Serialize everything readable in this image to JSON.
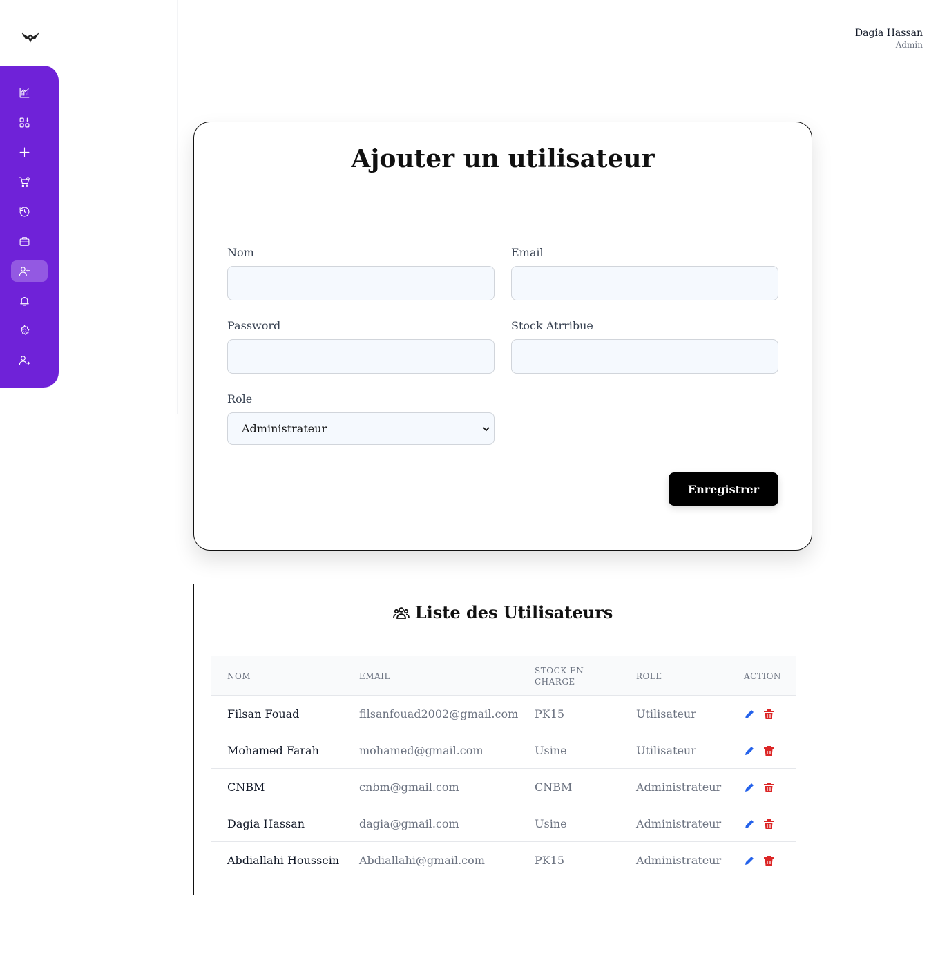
{
  "header": {
    "user_name": "Dagia Hassan",
    "user_role": "Admin"
  },
  "sidebar": {
    "accent_color": "#6f22d8",
    "items": [
      {
        "icon": "chart-icon",
        "active": false
      },
      {
        "icon": "grid-add-icon",
        "active": false
      },
      {
        "icon": "plus-icon",
        "active": false
      },
      {
        "icon": "cart-icon",
        "active": false
      },
      {
        "icon": "history-icon",
        "active": false
      },
      {
        "icon": "briefcase-icon",
        "active": false
      },
      {
        "icon": "user-add-icon",
        "active": true
      },
      {
        "icon": "bell-icon",
        "active": false
      },
      {
        "icon": "gear-icon",
        "active": false
      },
      {
        "icon": "user-logout-icon",
        "active": false
      }
    ]
  },
  "form": {
    "title": "Ajouter un utilisateur",
    "nom_label": "Nom",
    "nom_value": "",
    "email_label": "Email",
    "email_value": "",
    "password_label": "Password",
    "password_value": "",
    "stock_label": "Stock Atrribue",
    "stock_value": "",
    "role_label": "Role",
    "role_value": "Administrateur",
    "save_label": "Enregistrer"
  },
  "users": {
    "title": "Liste des Utilisateurs",
    "columns": [
      "NOM",
      "EMAIL",
      "STOCK EN CHARGE",
      "ROLE",
      "ACTION"
    ],
    "rows": [
      {
        "nom": "Filsan Fouad",
        "email": "filsanfouad2002@gmail.com",
        "stock": "PK15",
        "role": "Utilisateur"
      },
      {
        "nom": "Mohamed Farah",
        "email": "mohamed@gmail.com",
        "stock": "Usine",
        "role": "Utilisateur"
      },
      {
        "nom": "CNBM",
        "email": "cnbm@gmail.com",
        "stock": "CNBM",
        "role": "Administrateur"
      },
      {
        "nom": "Dagia Hassan",
        "email": "dagia@gmail.com",
        "stock": "Usine",
        "role": "Administrateur"
      },
      {
        "nom": "Abdiallahi Houssein",
        "email": "Abdiallahi@gmail.com",
        "stock": "PK15",
        "role": "Administrateur"
      }
    ],
    "edit_color": "#2563eb",
    "delete_color": "#dc2626"
  }
}
